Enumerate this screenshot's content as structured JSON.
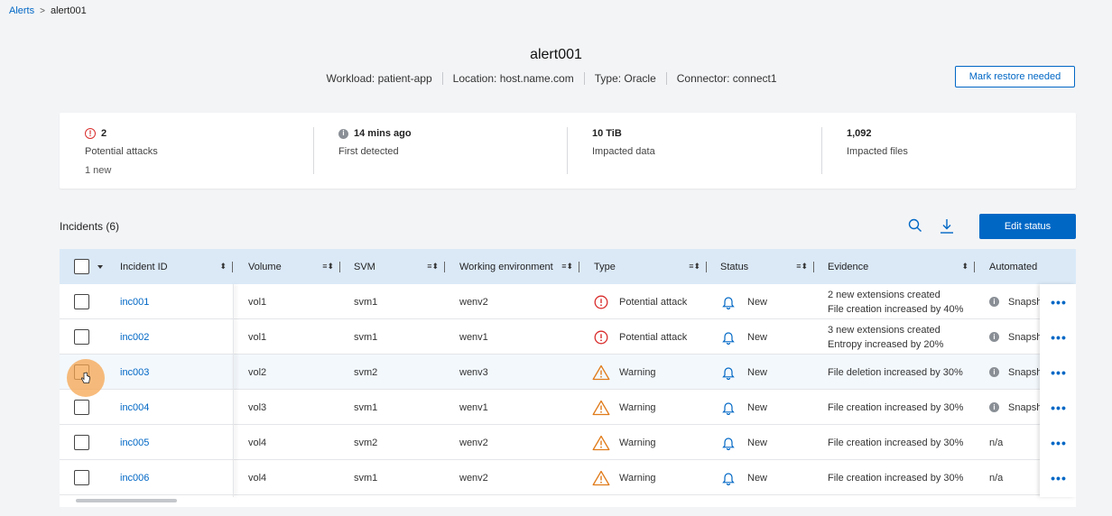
{
  "breadcrumb": {
    "root": "Alerts",
    "separator": ">",
    "current": "alert001"
  },
  "header": {
    "title": "alert001",
    "meta": [
      "Workload: patient-app",
      "Location: host.name.com",
      "Type: Oracle",
      "Connector: connect1"
    ],
    "restore_button": "Mark restore needed"
  },
  "summary": [
    {
      "value": "2",
      "label": "Potential attacks",
      "sub": "1 new",
      "icon": "alert-icon"
    },
    {
      "value": "14 mins ago",
      "label": "First detected",
      "sub": "",
      "icon": "info-icon"
    },
    {
      "value": "10 TiB",
      "label": "Impacted data",
      "sub": "",
      "icon": ""
    },
    {
      "value": "1,092",
      "label": "Impacted files",
      "sub": "",
      "icon": ""
    }
  ],
  "incidents": {
    "title": "Incidents (6)",
    "edit_button": "Edit status",
    "columns": [
      "Incident ID",
      "Volume",
      "SVM",
      "Working environment",
      "Type",
      "Status",
      "Evidence",
      "Automated"
    ],
    "rows": [
      {
        "id": "inc001",
        "volume": "vol1",
        "svm": "svm1",
        "env": "wenv2",
        "type": "Potential attack",
        "status": "New",
        "evidence": [
          "2 new extensions created",
          "File creation increased by 40%"
        ],
        "automated": "Snapsh"
      },
      {
        "id": "inc002",
        "volume": "vol1",
        "svm": "svm1",
        "env": "wenv1",
        "type": "Potential attack",
        "status": "New",
        "evidence": [
          "3 new extensions created",
          "Entropy increased by 20%"
        ],
        "automated": "Snapsh"
      },
      {
        "id": "inc003",
        "volume": "vol2",
        "svm": "svm2",
        "env": "wenv3",
        "type": "Warning",
        "status": "New",
        "evidence": [
          "File deletion increased by 30%"
        ],
        "automated": "Snapsh"
      },
      {
        "id": "inc004",
        "volume": "vol3",
        "svm": "svm1",
        "env": "wenv1",
        "type": "Warning",
        "status": "New",
        "evidence": [
          "File creation increased by 30%"
        ],
        "automated": "Snapsh"
      },
      {
        "id": "inc005",
        "volume": "vol4",
        "svm": "svm2",
        "env": "wenv2",
        "type": "Warning",
        "status": "New",
        "evidence": [
          "File creation increased by 30%"
        ],
        "automated": "n/a"
      },
      {
        "id": "inc006",
        "volume": "vol4",
        "svm": "svm1",
        "env": "wenv2",
        "type": "Warning",
        "status": "New",
        "evidence": [
          "File creation increased by 30%"
        ],
        "automated": "n/a"
      }
    ],
    "more_glyph": "•••"
  },
  "colors": {
    "accent": "#0067c5",
    "danger": "#d92d2d",
    "warning": "#e07b1a",
    "header_bg": "#dbe9f7"
  }
}
